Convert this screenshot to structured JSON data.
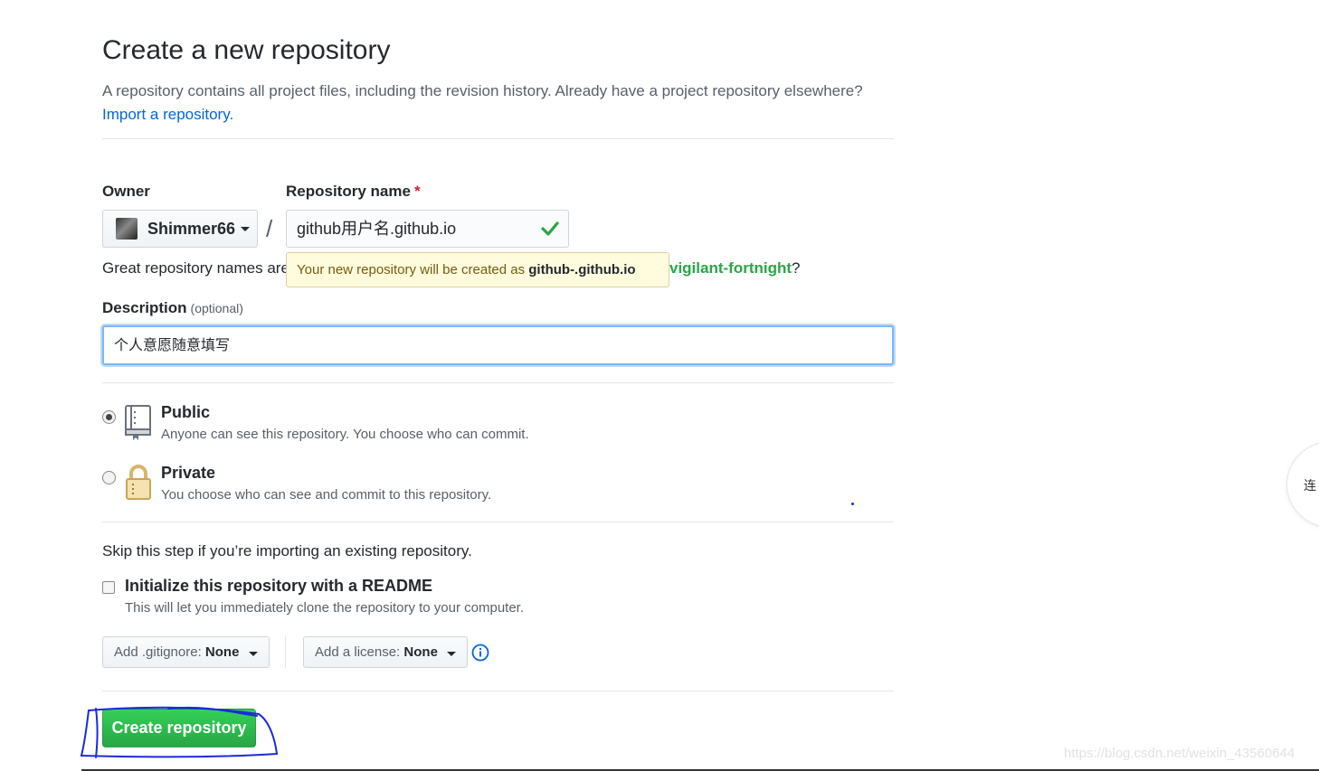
{
  "header": {
    "title": "Create a new repository",
    "subtitle": "A repository contains all project files, including the revision history. Already have a project repository elsewhere?",
    "import_link": "Import a repository."
  },
  "owner": {
    "label": "Owner",
    "value": "Shimmer66",
    "icon": "avatar"
  },
  "slash": "/",
  "repo_name": {
    "label": "Repository name",
    "required_mark": "*",
    "value": "github用户名.github.io",
    "valid_icon": "check-icon"
  },
  "hint": {
    "prefix": "Great repository names are",
    "suggestion": "vigilant-fortnight",
    "suffix": "?"
  },
  "tooltip": {
    "text": "Your new repository will be created as",
    "name": "github-.github.io"
  },
  "description": {
    "label": "Description",
    "optional": "(optional)",
    "value": "个人意愿随意填写"
  },
  "visibility": {
    "public": {
      "title": "Public",
      "note": "Anyone can see this repository. You choose who can commit.",
      "selected": true
    },
    "private": {
      "title": "Private",
      "note": "You choose who can see and commit to this repository.",
      "selected": false
    }
  },
  "init": {
    "skip_text": "Skip this step if you’re importing an existing repository.",
    "readme_title": "Initialize this repository with a README",
    "readme_note": "This will let you immediately clone the repository to your computer.",
    "checked": false
  },
  "gitignore": {
    "label": "Add .gitignore:",
    "value": "None"
  },
  "license": {
    "label": "Add a license:",
    "value": "None"
  },
  "create_button": "Create repository",
  "side_widget": "连",
  "watermark": "https://blog.csdn.net/weixin_43560644",
  "colors": {
    "primary_green": "#28a745",
    "link_blue": "#0366d6",
    "tooltip_bg": "#fffbdd",
    "annotation_blue": "#1a2bd8"
  }
}
